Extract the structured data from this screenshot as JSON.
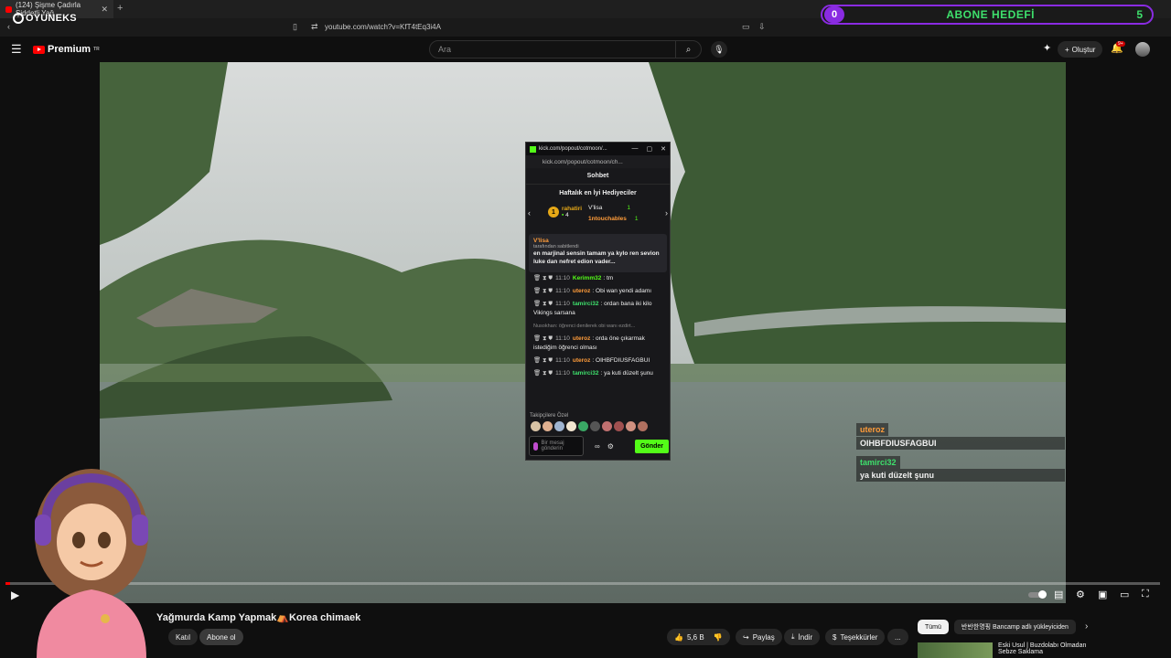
{
  "browser": {
    "tab_title": "(124) Şişme Çadırla Şiddetli Yağ",
    "new_tab": "+",
    "url": "youtube.com/watch?v=KfT4tEq3i4A",
    "brand": "OYUNEKS"
  },
  "goal_overlay": {
    "current": "0",
    "label": "ABONE HEDEFİ",
    "target": "5",
    "color": "#3ee06c"
  },
  "youtube": {
    "logo_text": "Premium",
    "logo_sup": "TR",
    "search_placeholder": "Ara",
    "create_label": "Oluştur",
    "notification_badge": "9+"
  },
  "video": {
    "title": "Yağmurda Kamp Yapmak⛺Korea chimaek",
    "progress_fraction": 0.004,
    "join_label": "Katıl",
    "subscribe_label": "Abone ol",
    "like_count": "5,6 B",
    "share_label": "Paylaş",
    "download_label": "İndir",
    "thanks_label": "Teşekkürler",
    "more_label": "..."
  },
  "filters": {
    "chips": [
      "Tümü",
      "반반한명핑 Bancamp adlı yükleyiciden"
    ],
    "next": "›"
  },
  "recommendation": {
    "title": "Eski Usul | Buzdolabı Olmadan",
    "subtitle": "Sebze Saklama"
  },
  "kick_popup": {
    "window_title": "kick.com/popout/cotmoon/...",
    "url": "kick.com/popout/cotmoon/ch...",
    "chat_header": "Sohbet",
    "gifters_header": "Haftalık en İyi Hediyeciler",
    "gifters": [
      {
        "rank": "1",
        "name": "rahatiri",
        "count": "4"
      },
      {
        "name": "V'lisa",
        "count": "1"
      },
      {
        "name": "1ntouchables",
        "count": "1"
      }
    ],
    "pinned": {
      "by_user": "V'lisa",
      "by_text": "tarafından sabitlendi",
      "text": "en marjinal sensin tamam ya kylo ren sevion luke dan nefret edion vader..."
    },
    "messages": [
      {
        "time": "11:10",
        "user": "Kerimm32",
        "text": "tm",
        "color": "#53fc18"
      },
      {
        "time": "11:10",
        "user": "uteroz",
        "text": "Obi wan yendi adamı",
        "color": "#ff9c3a"
      },
      {
        "time": "11:10",
        "user": "tamirci32",
        "text": "ordan bana iki kilo Vikings sarsana",
        "color": "#3ee06c"
      },
      {
        "reply": "Nusokhan: öğrenci denilerek obi wanı ezdirt..."
      },
      {
        "time": "11:10",
        "user": "uteroz",
        "text": "orda öne çıkarmak istediğim öğrenci olması",
        "color": "#ff9c3a"
      },
      {
        "time": "11:10",
        "user": "uteroz",
        "text": "OIHBFDIUSFAGBUI",
        "color": "#ff9c3a"
      },
      {
        "time": "11:10",
        "user": "tamirci32",
        "text": "ya kuti düzelt şunu",
        "color": "#3ee06c"
      }
    ],
    "emote_label": "Takipçilere Özel",
    "input_placeholder": "Bir mesaj gönderin",
    "send_label": "Gönder"
  },
  "overlay_chat": [
    {
      "user": "uteroz",
      "text": "OIHBFDIUSFAGBUI",
      "color": "#ff9c3a"
    },
    {
      "user": "tamirci32",
      "text": "ya kuti düzelt şunu",
      "color": "#3ee06c"
    }
  ]
}
